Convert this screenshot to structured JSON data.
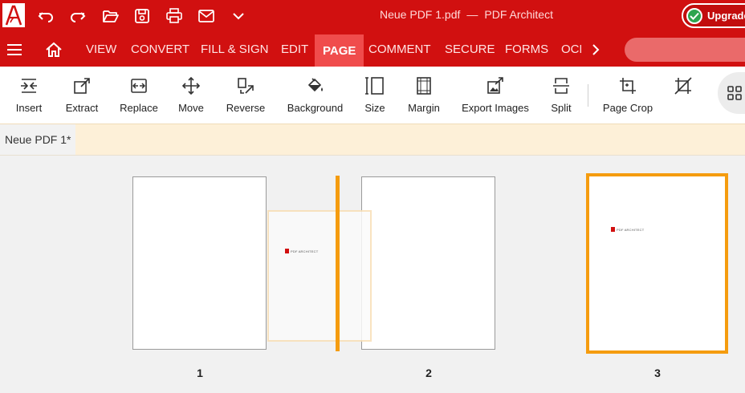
{
  "titlebar": {
    "app_logo": "pdf-architect-logo",
    "filename": "Neue PDF 1.pdf",
    "separator": "—",
    "app_name": "PDF Architect",
    "upgrade_label": "Upgrade",
    "quick_access": [
      "undo-icon",
      "redo-icon",
      "open-folder-icon",
      "save-icon",
      "print-icon",
      "mail-icon",
      "chevron-down-icon"
    ]
  },
  "menubar": {
    "tabs": [
      {
        "label": "VIEW"
      },
      {
        "label": "CONVERT"
      },
      {
        "label": "FILL & SIGN"
      },
      {
        "label": "EDIT"
      },
      {
        "label": "PAGE"
      },
      {
        "label": "COMMENT"
      },
      {
        "label": "SECURE"
      },
      {
        "label": "FORMS"
      },
      {
        "label": "OCR"
      }
    ],
    "active_tab": "PAGE"
  },
  "ribbon": {
    "buttons": [
      {
        "label": "Insert",
        "icon": "insert-page-icon"
      },
      {
        "label": "Extract",
        "icon": "extract-icon"
      },
      {
        "label": "Replace",
        "icon": "replace-icon"
      },
      {
        "label": "Move",
        "icon": "move-icon"
      },
      {
        "label": "Reverse",
        "icon": "reverse-icon"
      },
      {
        "label": "Background",
        "icon": "paint-bucket-icon"
      },
      {
        "label": "Size",
        "icon": "page-size-icon"
      },
      {
        "label": "Margin",
        "icon": "margin-icon"
      },
      {
        "label": "Export Images",
        "icon": "export-images-icon"
      },
      {
        "label": "Split",
        "icon": "split-icon"
      },
      {
        "label": "Page Crop",
        "icon": "crop-icon"
      }
    ]
  },
  "document_tab": {
    "label": "Neue PDF 1*"
  },
  "pages": [
    {
      "number": "1",
      "has_logo": false,
      "selected": false
    },
    {
      "number": "2",
      "has_logo": false,
      "selected": false
    },
    {
      "number": "3",
      "has_logo": true,
      "selected": true
    }
  ],
  "page_logo_text": "PDF ARCHITECT",
  "colors": {
    "brand_red": "#d11010",
    "active_tab": "#f04c4c",
    "selection_orange": "#f59c0f",
    "doc_strip": "#fdf0d8"
  }
}
